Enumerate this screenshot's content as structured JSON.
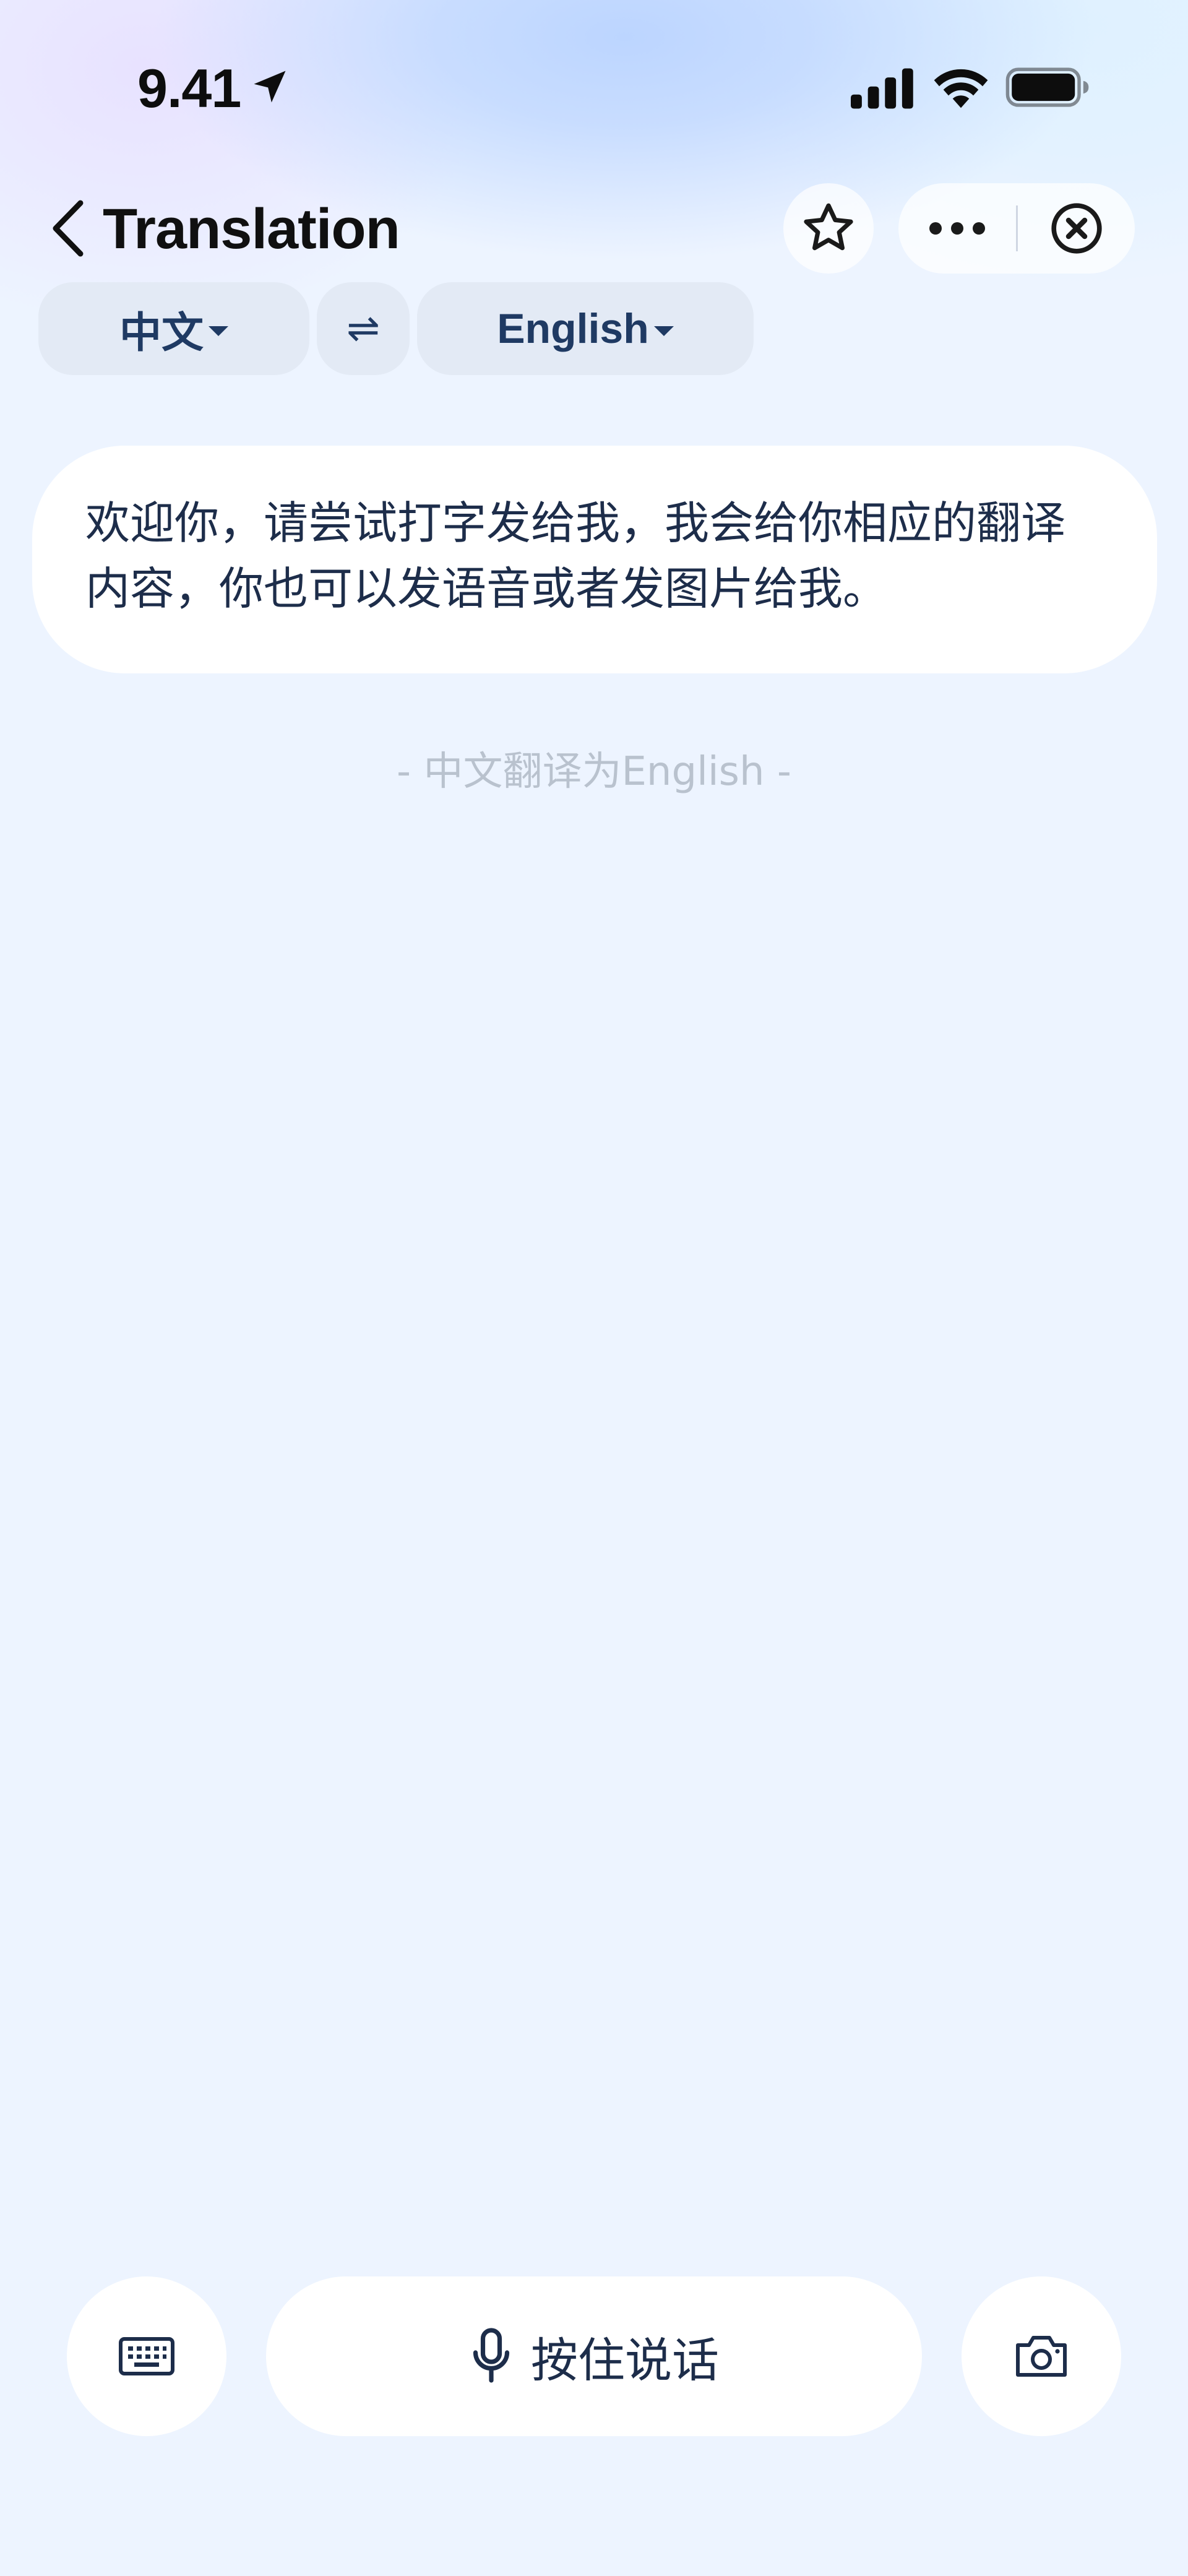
{
  "status_bar": {
    "time": "9.41",
    "icons": [
      "location-arrow-icon",
      "cellular-signal-icon",
      "wifi-icon",
      "battery-icon"
    ]
  },
  "nav": {
    "title": "Translation",
    "icons": [
      "chevron-left-icon",
      "star-icon",
      "more-icon",
      "close-circle-icon"
    ]
  },
  "languages": {
    "source": "中文",
    "target": "English",
    "swap_icon": "⇌"
  },
  "welcome_message": "欢迎你，请尝试打字发给我，我会给你相应的翻译内容，你也可以发语音或者发图片给我。",
  "direction_hint": "- 中文翻译为English -",
  "bottom_bar": {
    "talk_label": "按住说话",
    "icons": [
      "keyboard-icon",
      "microphone-icon",
      "camera-icon"
    ]
  },
  "colors": {
    "background": "#edf4ff",
    "accent_text": "#1f3a63",
    "pill_bg": "#e3eaf5",
    "hint_text": "#b9c2ce"
  }
}
